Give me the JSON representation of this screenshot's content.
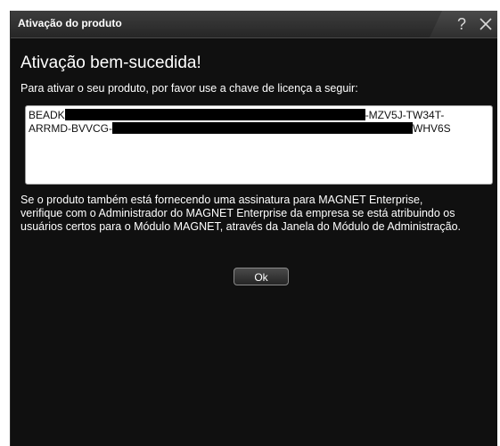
{
  "window": {
    "title": "Ativação do produto",
    "help_label": "?",
    "close_icon": "close-icon"
  },
  "content": {
    "heading": "Ativação bem-sucedida!",
    "instruction": "Para ativar o seu produto, por favor use a chave de licença a seguir:",
    "license_key": {
      "line1_start": "BEADK",
      "line1_end": "-MZV5J-TW34T-",
      "line2_start": "ARRMD-BVVCG-",
      "line2_end": "WHV6S"
    },
    "notice": "Se o produto também está fornecendo uma assinatura para MAGNET Enterprise, verifique com o Administrador do MAGNET Enterprise da empresa se está atribuindo os usuários certos para o Módulo MAGNET, através da Janela do Módulo de Administração.",
    "ok_label": "Ok"
  },
  "colors": {
    "dialog_bg": "#101010",
    "titlebar": "#333333",
    "text": "#ffffff",
    "key_bg": "#ffffff"
  }
}
